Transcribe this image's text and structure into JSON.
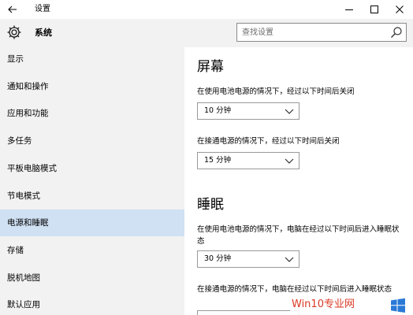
{
  "window": {
    "title": "设置",
    "back_icon": "back-arrow-icon",
    "controls": [
      "minimize-icon",
      "maximize-icon",
      "close-icon"
    ]
  },
  "sidebar": {
    "header_icon": "gear-icon",
    "header": "系统",
    "items": [
      {
        "label": "显示",
        "active": false
      },
      {
        "label": "通知和操作",
        "active": false
      },
      {
        "label": "应用和功能",
        "active": false
      },
      {
        "label": "多任务",
        "active": false
      },
      {
        "label": "平板电脑模式",
        "active": false
      },
      {
        "label": "节电模式",
        "active": false
      },
      {
        "label": "电源和睡眠",
        "active": true
      },
      {
        "label": "存储",
        "active": false
      },
      {
        "label": "脱机地图",
        "active": false
      },
      {
        "label": "默认应用",
        "active": false
      }
    ]
  },
  "search": {
    "placeholder": "查找设置",
    "icon": "search-icon"
  },
  "screen": {
    "title": "屏幕",
    "battery_label": "在使用电池电源的情况下，经过以下时间后关闭",
    "battery_value": "10 分钟",
    "plugged_label": "在接通电源的情况下，经过以下时间后关闭",
    "plugged_value": "15 分钟"
  },
  "sleep": {
    "title": "睡眠",
    "battery_label": "在使用电池电源的情况下，电脑在经过以下时间后进入睡眠状态",
    "battery_value": "30 分钟",
    "plugged_label": "在接通电源的情况下，电脑在经过以下时间后进入睡眠状态"
  },
  "watermark": {
    "text": "Win10专业网",
    "logo": "windows-logo-icon"
  },
  "colors": {
    "sidebar_bg": "#f2f2f2",
    "active_item": "#cfe1f3",
    "watermark": "#d93a25",
    "logo_blue": "#2a79d6"
  }
}
